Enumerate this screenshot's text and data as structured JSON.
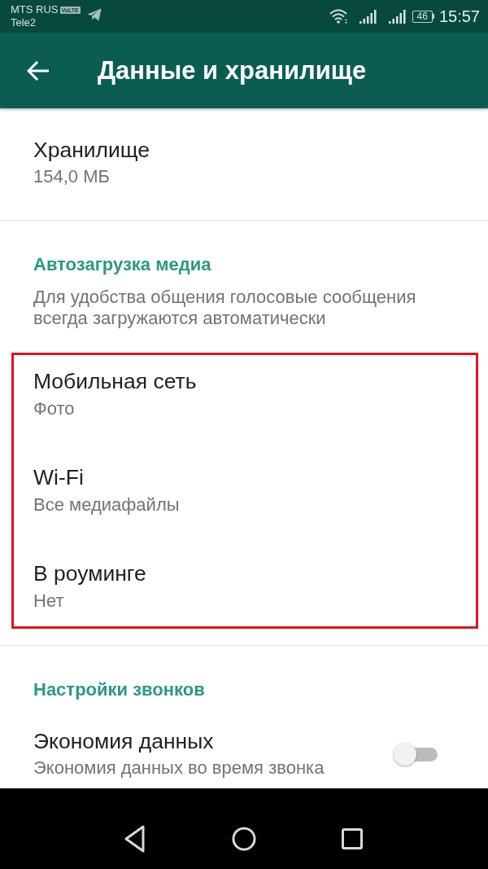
{
  "status_bar": {
    "carrier": "MTS RUS",
    "volte_badge": "VoLTE",
    "carrier_2": "Tele2",
    "battery": "46",
    "time": "15:57"
  },
  "app_bar": {
    "title": "Данные и хранилище"
  },
  "storage": {
    "title": "Хранилище",
    "subtitle": "154,0 МБ"
  },
  "sections": [
    {
      "header": "Автозагрузка медиа",
      "description": "Для удобства общения голосовые сообщения всегда загружаются автоматически",
      "highlighted": true,
      "items": [
        {
          "kind": "option",
          "title": "Мобильная сеть",
          "value": "Фото"
        },
        {
          "kind": "option",
          "title": "Wi-Fi",
          "value": "Все медиафайлы"
        },
        {
          "kind": "option",
          "title": "В роуминге",
          "value": "Нет"
        }
      ]
    },
    {
      "header": "Настройки звонков",
      "highlighted": false,
      "items": [
        {
          "kind": "toggle",
          "title": "Экономия данных",
          "subtitle": "Экономия данных во время звонка",
          "on": false
        }
      ]
    }
  ]
}
